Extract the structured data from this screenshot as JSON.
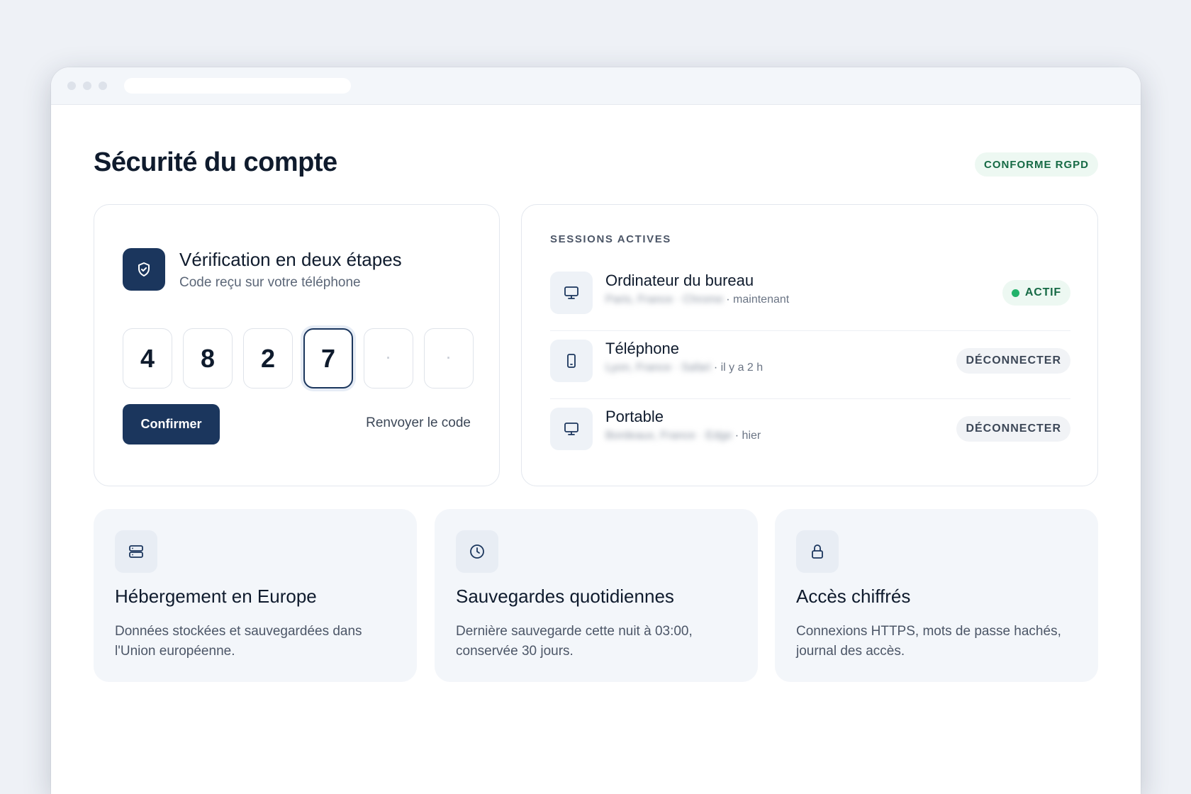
{
  "page": {
    "title": "Sécurité du compte",
    "compliance_badge": "CONFORME RGPD"
  },
  "two_factor": {
    "title": "Vérification en deux étapes",
    "subtitle": "Code reçu sur votre téléphone",
    "digits": [
      "4",
      "8",
      "2",
      "7",
      "·",
      "·"
    ],
    "confirm_label": "Confirmer",
    "resend_label": "Renvoyer le code"
  },
  "sessions": {
    "label": "SESSIONS ACTIVES",
    "items": [
      {
        "name": "Ordinateur du bureau",
        "location": "Paris, France · Chrome",
        "when": "· maintenant",
        "status": "ACTIF",
        "icon": "monitor-icon"
      },
      {
        "name": "Téléphone",
        "location": "Lyon, France · Safari",
        "when": "· il y a 2 h",
        "action": "DÉCONNECTER",
        "icon": "smartphone-icon"
      },
      {
        "name": "Portable",
        "location": "Bordeaux, France · Edge",
        "when": "· hier",
        "action": "DÉCONNECTER",
        "icon": "monitor-icon"
      }
    ]
  },
  "features": [
    {
      "title": "Hébergement en Europe",
      "desc": "Données stockées et sauvegardées dans l'Union européenne.",
      "icon": "server-icon"
    },
    {
      "title": "Sauvegardes quotidiennes",
      "desc": "Dernière sauvegarde cette nuit à 03:00, conservée 30 jours.",
      "icon": "clock-icon"
    },
    {
      "title": "Accès chiffrés",
      "desc": "Connexions HTTPS, mots de passe hachés, journal des accès.",
      "icon": "lock-icon"
    }
  ],
  "colors": {
    "primary": "#1b365d",
    "success": "#22b26a",
    "success_bg": "#edf8f2"
  }
}
